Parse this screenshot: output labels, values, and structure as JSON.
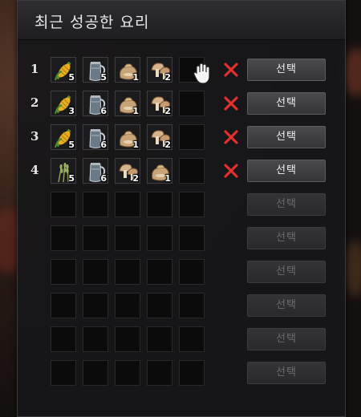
{
  "window": {
    "title": "최근 성공한 요리"
  },
  "select_label": "선택",
  "rows": [
    {
      "number": "1",
      "enabled": true,
      "items": [
        {
          "icon": "corn-icon",
          "count": "5"
        },
        {
          "icon": "water-jug-icon",
          "count": "5"
        },
        {
          "icon": "flour-sack-icon",
          "count": "1"
        },
        {
          "icon": "mushroom-icon",
          "count": "2"
        }
      ]
    },
    {
      "number": "2",
      "enabled": true,
      "items": [
        {
          "icon": "corn-icon",
          "count": "3"
        },
        {
          "icon": "water-jug-icon",
          "count": "6"
        },
        {
          "icon": "flour-sack-icon",
          "count": "1"
        },
        {
          "icon": "mushroom-icon",
          "count": "2"
        }
      ]
    },
    {
      "number": "3",
      "enabled": true,
      "items": [
        {
          "icon": "corn-icon",
          "count": "5"
        },
        {
          "icon": "water-jug-icon",
          "count": "6"
        },
        {
          "icon": "flour-sack-icon",
          "count": "1"
        },
        {
          "icon": "mushroom-icon",
          "count": "2"
        }
      ]
    },
    {
      "number": "4",
      "enabled": true,
      "items": [
        {
          "icon": "wheat-icon",
          "count": "5"
        },
        {
          "icon": "water-jug-icon",
          "count": "6"
        },
        {
          "icon": "mushroom-icon",
          "count": "2"
        },
        {
          "icon": "flour-sack-icon",
          "count": "1"
        }
      ]
    },
    {
      "number": "",
      "enabled": false,
      "items": []
    },
    {
      "number": "",
      "enabled": false,
      "items": []
    },
    {
      "number": "",
      "enabled": false,
      "items": []
    },
    {
      "number": "",
      "enabled": false,
      "items": []
    },
    {
      "number": "",
      "enabled": false,
      "items": []
    },
    {
      "number": "",
      "enabled": false,
      "items": []
    }
  ],
  "colors": {
    "delete": "#e03030",
    "button_text": "#f0f0f0",
    "button_disabled_text": "#6c6c70"
  }
}
